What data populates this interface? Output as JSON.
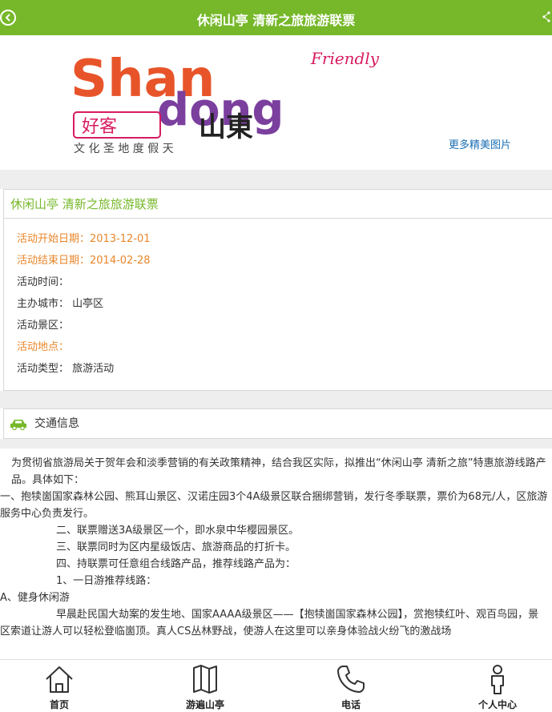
{
  "header": {
    "title": "休闲山亭 清新之旅旅游联票"
  },
  "banner": {
    "logo_words": [
      "Shan",
      "dong",
      "Friendly"
    ],
    "logo_cn": "好客",
    "logo_cn2": "山東",
    "logo_tagline": "文 化 圣 地    度 假 天",
    "more_link": "更多精美图片"
  },
  "event": {
    "title": "休闲山亭 清新之旅旅游联票",
    "start_label": "活动开始日期：",
    "start_value": "2013-12-01",
    "end_label": "活动结束日期：",
    "end_value": "2014-02-28",
    "time_label": "活动时间：",
    "city_label": "主办城市：",
    "city_value": "山亭区",
    "scenic_label": "活动景区：",
    "place_label": "活动地点：",
    "type_label": "活动类型：",
    "type_value": "旅游活动"
  },
  "traffic": {
    "title": "交通信息"
  },
  "article": {
    "p1": "为贯彻省旅游局关于贺年会和淡季营销的有关政策精神，结合我区实际，拟推出“休闲山亭 清新之旅”特惠旅游线路产品。具体如下：",
    "p2": "一、抱犊崮国家森林公园、熊耳山景区、汉诺庄园3个4A级景区联合捆绑营销，发行冬季联票，票价为68元/人，区旅游服务中心负责发行。",
    "p3": "二、联票赠送3A级景区一个，即水泉中华樱园景区。",
    "p4": "三、联票同时为区内星级饭店、旅游商品的打折卡。",
    "p5": "四、持联票可任意组合线路产品，推荐线路产品为：",
    "p6": "1、一日游推荐线路：",
    "p7": "A、健身休闲游",
    "p8": "早晨赴民国大劫案的发生地、国家AAAA级景区——【抱犊崮国家森林公园】，赏抱犊红叶、观百鸟园，景区索道让游人可以轻松登临崮顶。真人CS丛林野战，使游人在这里可以亲身体验战火纷飞的激战场"
  },
  "nav": {
    "home": "首页",
    "tour": "游遍山亭",
    "phone": "电话",
    "user": "个人中心"
  },
  "colors": {
    "brand_green": "#76b82a",
    "date_orange": "#e8862a",
    "link_blue": "#1a6fb5"
  }
}
